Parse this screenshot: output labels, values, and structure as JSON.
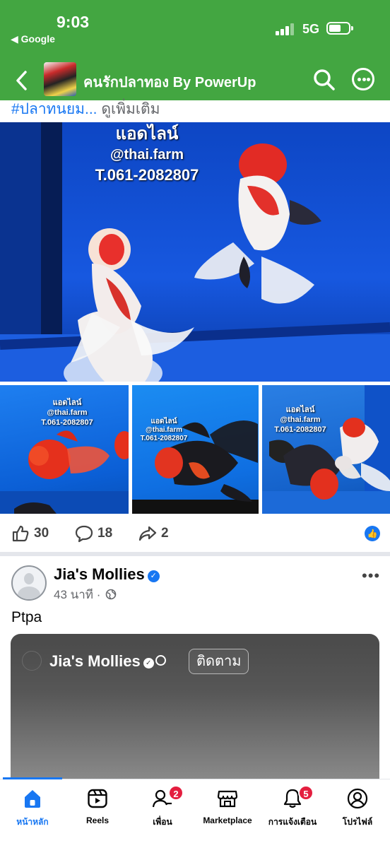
{
  "status_bar": {
    "time": "9:03",
    "back_app": "◀ Google",
    "network": "5G"
  },
  "header": {
    "title": "คนรักปลาทอง By PowerUp",
    "back_icon": "chevron-left-icon",
    "search_icon": "search-icon",
    "more_icon": "more-horizontal-icon",
    "background": "#43a641"
  },
  "post1": {
    "text_tail": "#ปลาทนยม...",
    "see_more": " ดูเพิ่มเติม",
    "main_photo_text": [
      "แอดไลน์",
      "@thai.farm",
      "T.061-2082807"
    ],
    "thumb_photo_text": [
      "แอดไลน์",
      "@thai.farm",
      "T.061-2082807"
    ],
    "likes": "30",
    "comments": "18",
    "shares": "2"
  },
  "post2": {
    "author": "Jia's Mollies",
    "time": "43 นาที ·",
    "text": "Ptpa",
    "reel_author": "Jia's Mollies",
    "follow_label": "ติดตาม"
  },
  "tabbar": {
    "items": [
      {
        "label": "หน้าหลัก",
        "icon": "home-icon",
        "active": true
      },
      {
        "label": "Reels",
        "icon": "reels-icon"
      },
      {
        "label": "เพื่อน",
        "icon": "friends-icon",
        "badge": "2"
      },
      {
        "label": "Marketplace",
        "icon": "marketplace-icon"
      },
      {
        "label": "การแจ้งเตือน",
        "icon": "bell-icon",
        "badge": "5"
      },
      {
        "label": "โปรไฟล์",
        "icon": "profile-icon"
      }
    ],
    "accent": "#1877f2"
  }
}
